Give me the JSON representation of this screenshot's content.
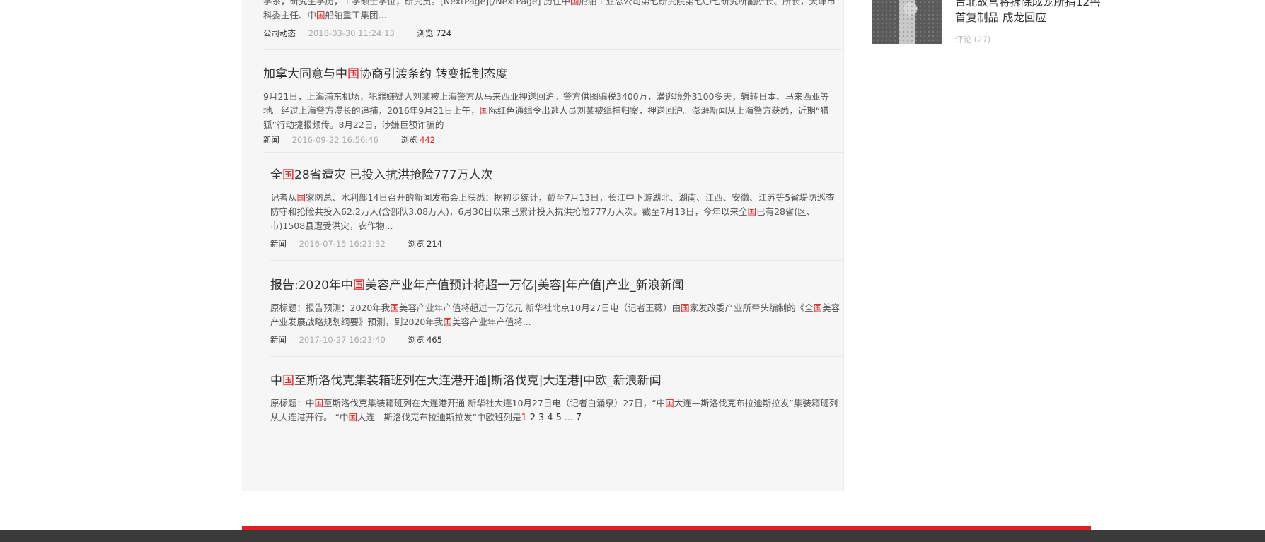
{
  "articles": [
    {
      "title": "",
      "summary_parts": [
        {
          "t": "学系，研究生学历，工学硕士学位，研究员。[NextPage][/NextPage]        历任中"
        },
        {
          "t": "国",
          "hl": true
        },
        {
          "t": "船舶工业总公司第七研究院第七〇七研究所副所长、所长，天津市科委主任、中"
        },
        {
          "t": "国",
          "hl": true
        },
        {
          "t": "船舶重工集团..."
        }
      ],
      "category": "公司动态",
      "date": "2018-03-30 11:24:13",
      "views_label": "浏览",
      "views": "724",
      "views_hot": false
    },
    {
      "title_parts": [
        {
          "t": "加拿大同意与中"
        },
        {
          "t": "国",
          "hl": true
        },
        {
          "t": "协商引渡条约 转变抵制态度"
        }
      ],
      "summary_parts": [
        {
          "t": "9月21日，上海浦东机场，犯罪嫌疑人刘某被上海警方从马来西亚押送回沪。警方供图骗税3400万，潜逃境外3100多天，辗转日本、马来西亚等地。经过上海警方漫长的追捕，2016年9月21日上午，"
        },
        {
          "t": "国",
          "hl": true
        },
        {
          "t": "际红色通缉令出逃人员刘某被缉捕归案，押送回沪。澎湃新闻从上海警方获悉，近期“猎狐”行动捷报频传。8月22日，涉嫌巨额诈骗的"
        }
      ],
      "category": "新闻",
      "date": "2016-09-22 16:56:46",
      "views_label": "浏览",
      "views": "442",
      "views_hot": true
    },
    {
      "title_parts": [
        {
          "t": "全"
        },
        {
          "t": "国",
          "hl": true
        },
        {
          "t": "28省遭灾 已投入抗洪抢险777万人次"
        }
      ],
      "summary_parts": [
        {
          "t": "记者从"
        },
        {
          "t": "国",
          "hl": true
        },
        {
          "t": "家防总、水利部14日召开的新闻发布会上获悉：据初步统计，截至7月13日，长江中下游湖北、湖南、江西、安徽、江苏等5省堤防巡查防守和抢险共投入62.2万人(含部队3.08万人)，6月30日以来已累计投入抗洪抢险777万人次。截至7月13日，今年以来全"
        },
        {
          "t": "国",
          "hl": true
        },
        {
          "t": "已有28省(区、市)1508县遭受洪灾，农作物..."
        }
      ],
      "category": "新闻",
      "date": "2016-07-15 16:23:32",
      "views_label": "浏览",
      "views": "214",
      "views_hot": false
    },
    {
      "title_parts": [
        {
          "t": "报告:2020年中"
        },
        {
          "t": "国",
          "hl": true
        },
        {
          "t": "美容产业年产值预计将超一万亿|美容|年产值|产业_新浪新闻"
        }
      ],
      "summary_parts": [
        {
          "t": "        原标题：报告预测：2020年我"
        },
        {
          "t": "国",
          "hl": true
        },
        {
          "t": "美容产业年产值将超过一万亿元        新华社北京10月27日电（记者王薇）由"
        },
        {
          "t": "国",
          "hl": true
        },
        {
          "t": "家发改委产业所牵头编制的《全"
        },
        {
          "t": "国",
          "hl": true
        },
        {
          "t": "美容产业发展战略规划纲要》预测，到2020年我"
        },
        {
          "t": "国",
          "hl": true
        },
        {
          "t": "美容产业年产值将..."
        }
      ],
      "category": "新闻",
      "date": "2017-10-27 16:23:40",
      "views_label": "浏览",
      "views": "465",
      "views_hot": false
    },
    {
      "title_parts": [
        {
          "t": "中"
        },
        {
          "t": "国",
          "hl": true
        },
        {
          "t": "至斯洛伐克集装箱班列在大连港开通|斯洛伐克|大连港|中欧_新浪新闻"
        }
      ],
      "summary_parts": [
        {
          "t": "        原标题：中"
        },
        {
          "t": "国",
          "hl": true
        },
        {
          "t": "至斯洛伐克集装箱班列在大连港开通        新华社大连10月27日电（记者白涌泉）27日，“中"
        },
        {
          "t": "国",
          "hl": true
        },
        {
          "t": "大连—斯洛伐克布拉迪斯拉发”集装箱班列从大连港开行。        “中"
        },
        {
          "t": "国",
          "hl": true
        },
        {
          "t": "大连—斯洛伐克布拉迪斯拉发”中欧班列是"
        }
      ]
    }
  ],
  "pagination": {
    "pages": [
      "1",
      "2",
      "3",
      "4",
      "5"
    ],
    "current": "1",
    "ellipsis": "...",
    "last": "7"
  },
  "sidebar": {
    "title": "台北故宫将拆除成龙所捐12兽首复制品 成龙回应",
    "comments": "评论 (27)"
  },
  "colors": {
    "accent": "#e02020",
    "footer": "#3a3a3a",
    "panel": "#f6f6f6"
  }
}
